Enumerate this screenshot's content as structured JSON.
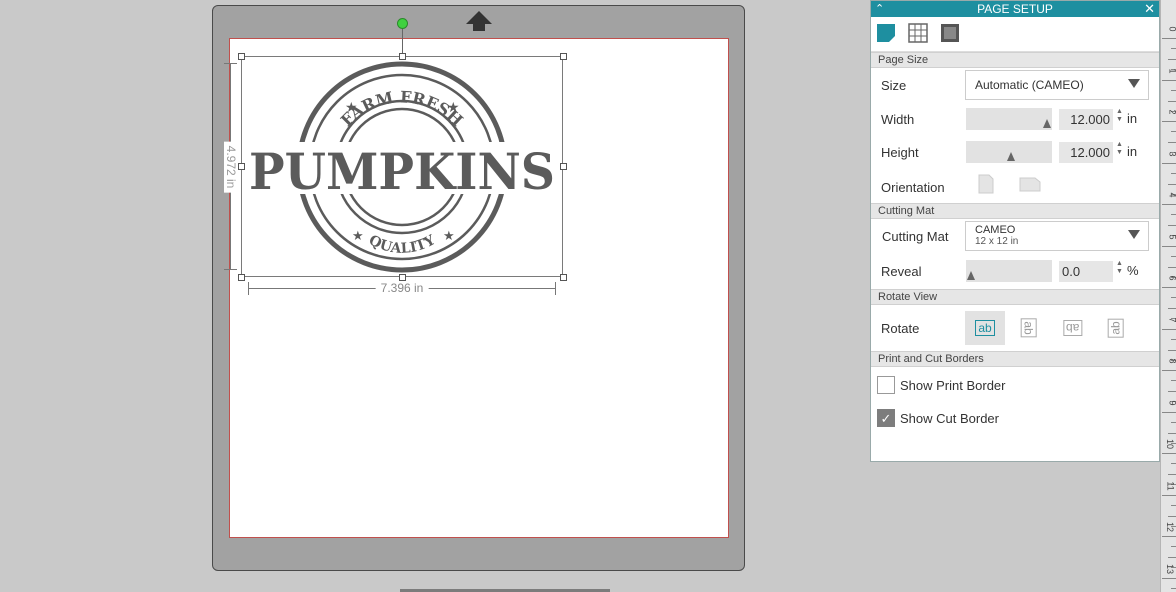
{
  "workspace": {
    "stamp": {
      "top_text": "FARM FRESH",
      "main_text": "PUMPKINS",
      "bottom_text": "QUALITY"
    },
    "dimension_width": "7.396 in",
    "dimension_height": "4.972 in"
  },
  "panel": {
    "title": "PAGE SETUP",
    "sections": {
      "page_size": "Page Size",
      "cutting_mat": "Cutting Mat",
      "rotate_view": "Rotate View",
      "print_cut_borders": "Print and Cut Borders"
    },
    "size": {
      "label": "Size",
      "value": "Automatic (CAMEO)"
    },
    "width": {
      "label": "Width",
      "value": "12.000",
      "unit": "in"
    },
    "height": {
      "label": "Height",
      "value": "12.000",
      "unit": "in"
    },
    "orientation": {
      "label": "Orientation"
    },
    "mat": {
      "label": "Cutting Mat",
      "value_line1": "CAMEO",
      "value_line2": "12 x 12 in"
    },
    "reveal": {
      "label": "Reveal",
      "value": "0.0",
      "unit": "%"
    },
    "rotate": {
      "label": "Rotate",
      "options": [
        "ab",
        "ab",
        "ab",
        "ab"
      ],
      "selected_index": 0
    },
    "show_print_border": {
      "label": "Show Print Border",
      "checked": false
    },
    "show_cut_border": {
      "label": "Show Cut Border",
      "checked": true
    }
  },
  "ruler": {
    "labels": [
      "0",
      "1",
      "2",
      "3",
      "4",
      "5",
      "6",
      "7",
      "8",
      "9",
      "10",
      "11",
      "12",
      "13"
    ]
  },
  "colors": {
    "accent": "#1e8fa0",
    "stamp": "#5b5b5b",
    "page_border": "#c0504d",
    "handle": "#3fd13f"
  }
}
